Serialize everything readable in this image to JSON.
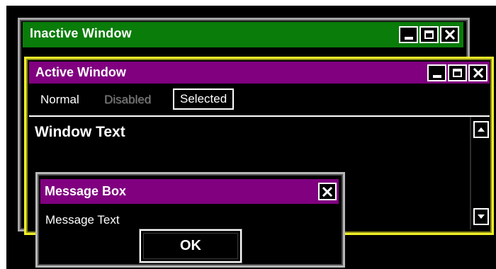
{
  "inactive_window": {
    "title": "Inactive Window",
    "title_color": "#0a7c0a",
    "frame_color": "#a6a6a6",
    "controls": [
      "minimize-icon",
      "maximize-icon",
      "close-icon"
    ]
  },
  "active_window": {
    "title": "Active Window",
    "title_color": "#800080",
    "frame_color": "#f0ef28",
    "controls": [
      "minimize-icon",
      "maximize-icon",
      "close-icon"
    ],
    "menu": {
      "normal": "Normal",
      "disabled": "Disabled",
      "selected": "Selected"
    },
    "client_text": "Window Text",
    "scrollbar": {
      "up_icon": "scroll-up-arrow-icon",
      "down_icon": "scroll-down-arrow-icon"
    }
  },
  "message_box": {
    "title": "Message Box",
    "title_color": "#800080",
    "text": "Message Text",
    "ok_label": "OK",
    "controls": [
      "close-icon"
    ]
  },
  "theme": {
    "background": "#000000",
    "text": "#ffffff",
    "disabled_text": "#7d7d7d"
  }
}
